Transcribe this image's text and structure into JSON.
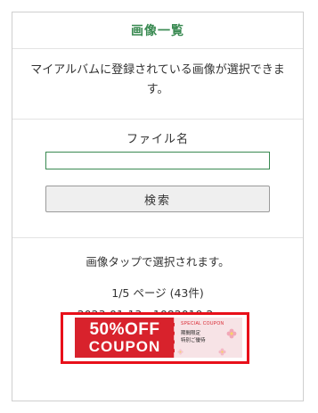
{
  "header": {
    "title": "画像一覧"
  },
  "description": {
    "text": "マイアルバムに登録されている画像が選択できます。"
  },
  "search": {
    "label": "ファイル名",
    "input_value": "",
    "button_label": "検索"
  },
  "results": {
    "hint": "画像タップで選択されます。",
    "page_info": "1/5 ページ (43件)",
    "file_info": "2023-01-13　1082019.2.png"
  },
  "coupon": {
    "big_text": "50%OFF",
    "word_text": "COUPON",
    "special_text": "SPECIAL COUPON",
    "sub_text_1": "期間限定",
    "sub_text_2": "特別ご優待"
  },
  "colors": {
    "title_green": "#3a8a52",
    "input_border": "#3a8a52",
    "highlight_red": "#e8101a",
    "coupon_red": "#d8222c",
    "coupon_pink": "#f7e3e6"
  }
}
